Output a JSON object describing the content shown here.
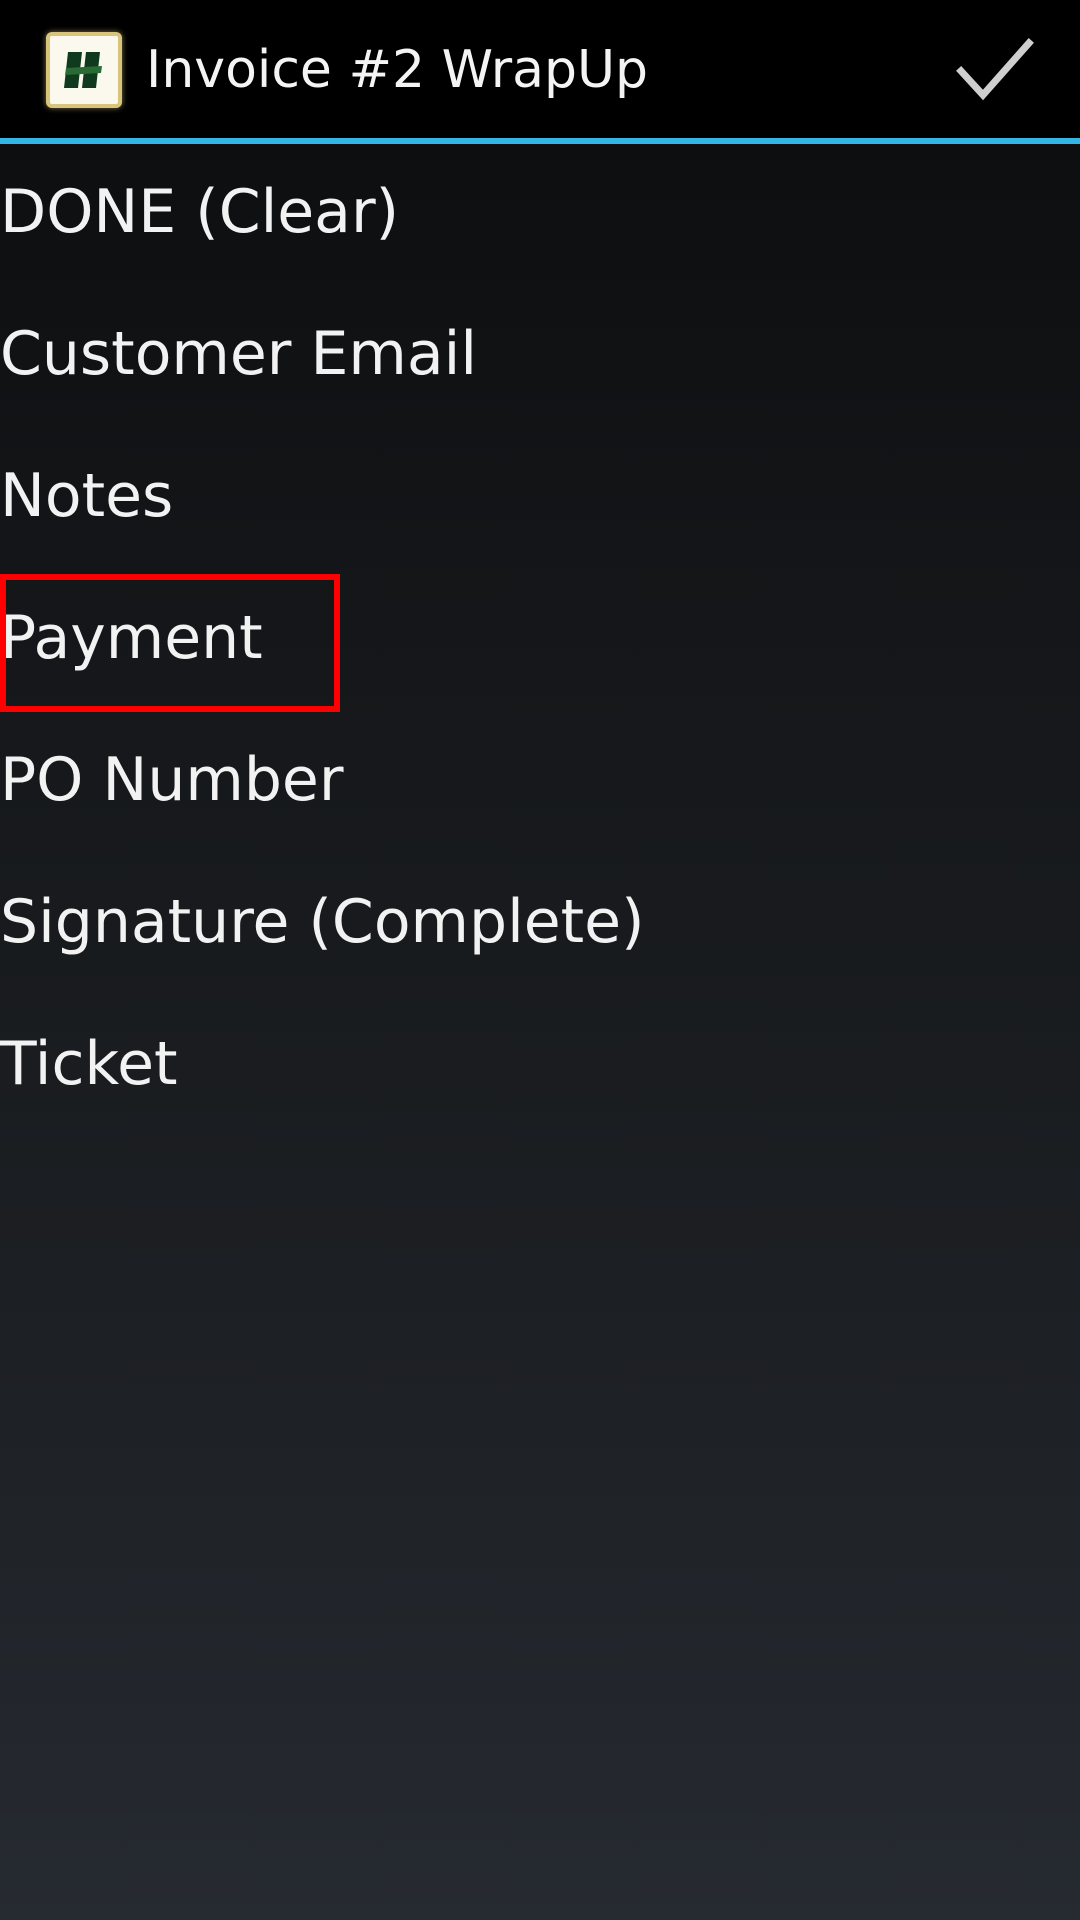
{
  "action_bar": {
    "title": "Invoice #2 WrapUp",
    "app_icon": "app-logo-icon",
    "confirm_icon": "checkmark-icon",
    "divider_color": "#33b5e5"
  },
  "menu": {
    "items": [
      {
        "label": "DONE (Clear)"
      },
      {
        "label": "Customer Email"
      },
      {
        "label": "Notes"
      },
      {
        "label": "Payment"
      },
      {
        "label": "PO Number"
      },
      {
        "label": "Signature (Complete)"
      },
      {
        "label": "Ticket"
      }
    ],
    "highlighted_item": "Payment",
    "highlight_color": "#ff0000"
  }
}
